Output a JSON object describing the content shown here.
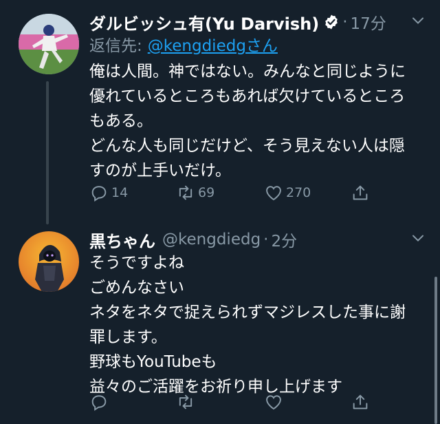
{
  "tweets": [
    {
      "name": "ダルビッシュ有(Yu Darvish)",
      "verified": true,
      "time": "17分",
      "reply_prefix": "返信先:",
      "reply_mention": "@kengdiedgさん",
      "lines": [
        "俺は人間。神ではない。みんなと同じように",
        "優れているところもあれば欠けているところ",
        "もある。",
        "どんな人も同じだけど、そう見えない人は隠",
        "すのが上手いだけ。"
      ],
      "reply_count": "14",
      "retweet_count": "69",
      "like_count": "270"
    },
    {
      "name": "黒ちゃん",
      "handle": "@kengdiedg",
      "time": "2分",
      "lines": [
        "そうですよね",
        "ごめんなさい",
        "ネタをネタで捉えられずマジレスした事に謝",
        "罪します。",
        "野球もYouTubeも",
        "益々のご活躍をお祈り申し上げます"
      ]
    }
  ],
  "colors": {
    "background": "#15202b",
    "secondary_text": "#8899a6",
    "link": "#1da1f2",
    "verified": "#ffffff"
  },
  "icons": [
    "verified-icon",
    "chevron-down-icon",
    "reply-icon",
    "retweet-icon",
    "like-icon",
    "share-icon"
  ]
}
